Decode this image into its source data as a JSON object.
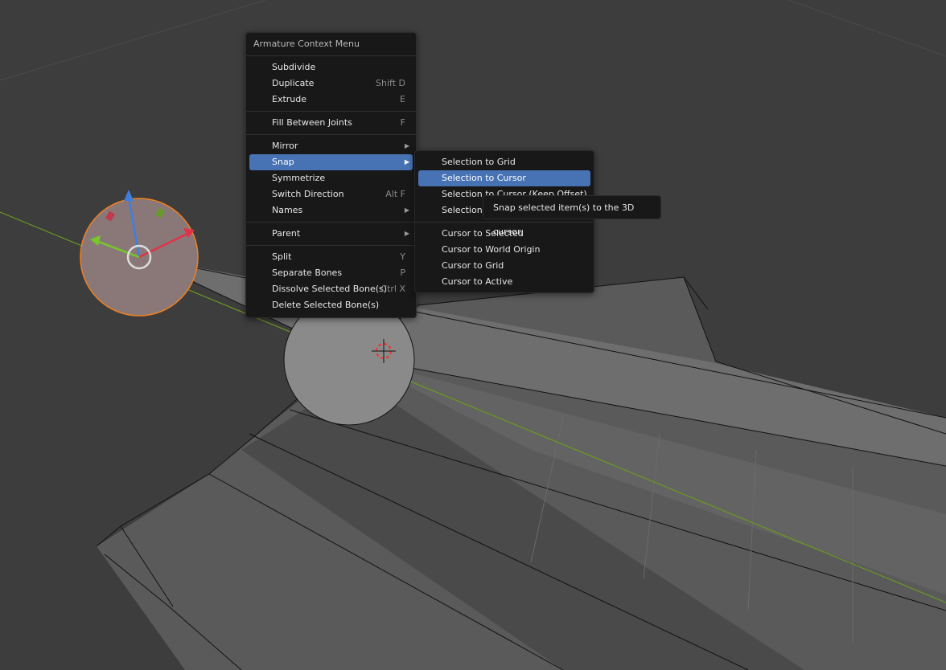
{
  "context_menu": {
    "title": "Armature Context Menu",
    "groups": [
      [
        {
          "label": "Subdivide",
          "shortcut": ""
        },
        {
          "label": "Duplicate",
          "shortcut": "Shift D"
        },
        {
          "label": "Extrude",
          "shortcut": "E"
        }
      ],
      [
        {
          "label": "Fill Between Joints",
          "shortcut": "F"
        }
      ],
      [
        {
          "label": "Mirror",
          "shortcut": ""
        },
        {
          "label": "Snap",
          "shortcut": ""
        },
        {
          "label": "Symmetrize",
          "shortcut": ""
        },
        {
          "label": "Switch Direction",
          "shortcut": "Alt F"
        },
        {
          "label": "Names",
          "shortcut": ""
        }
      ],
      [
        {
          "label": "Parent",
          "shortcut": ""
        }
      ],
      [
        {
          "label": "Split",
          "shortcut": "Y"
        },
        {
          "label": "Separate Bones",
          "shortcut": "P"
        },
        {
          "label": "Dissolve Selected Bone(s)",
          "shortcut": "Ctrl X"
        },
        {
          "label": "Delete Selected Bone(s)",
          "shortcut": ""
        }
      ]
    ]
  },
  "snap_submenu": {
    "items": [
      "Selection to Grid",
      "Selection to Cursor",
      "Selection to Cursor (Keep Offset)",
      "Selection to Active",
      "Cursor to Selected",
      "Cursor to World Origin",
      "Cursor to Grid",
      "Cursor to Active"
    ]
  },
  "tooltip": "Snap selected item(s) to the 3D cursor.",
  "colors": {
    "accent": "#4772b3",
    "selection_outline": "#f08020",
    "axis_x": "#e0334a",
    "axis_y": "#76c62c",
    "axis_z": "#3d7ee0"
  }
}
